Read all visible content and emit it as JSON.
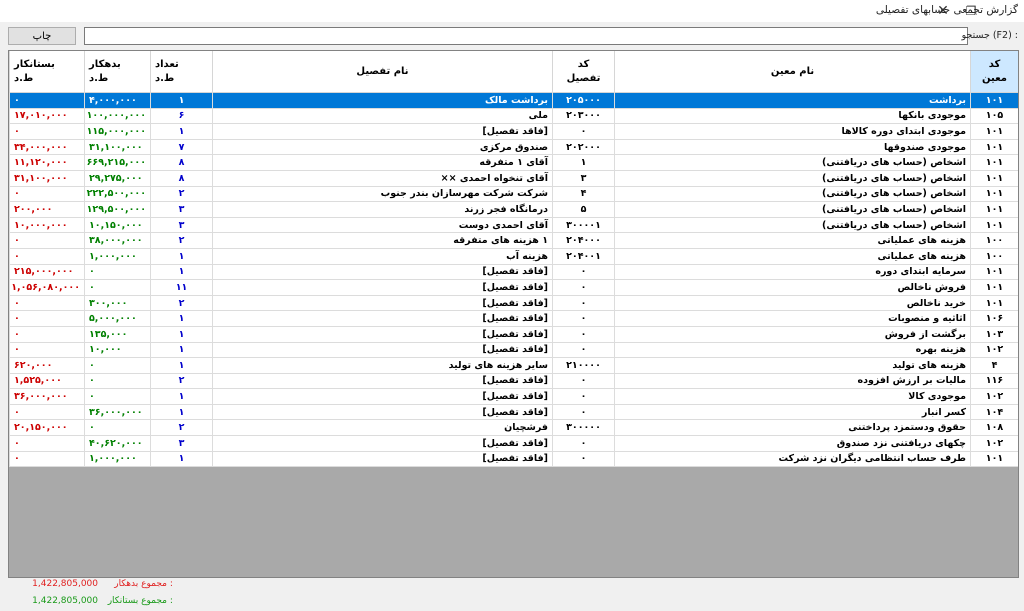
{
  "window": {
    "title": "گزارش تجمعی حسابهای تفصیلی",
    "restore_glyph": "❐",
    "close_glyph": "✕"
  },
  "toolbar": {
    "print_label": "چاپ",
    "search_label": "جستجو (F2) :",
    "search_value": ""
  },
  "columns": {
    "moin_code": "کد\nمعین",
    "moin_name": "نام معین",
    "detail_code": "کد\nتفصیل",
    "detail_name": "نام تفصیل",
    "count": "تعداد\nط.د",
    "debit": "بدهکار\nط.د",
    "credit": "بستانکار\nط.د"
  },
  "rows": [
    {
      "moin_code": "۱۰۱",
      "moin_name": "برداشت",
      "detail_code": "۲۰۵۰۰۰",
      "detail_name": "برداشت مالک",
      "count": "۱",
      "debit": "۴,۰۰۰,۰۰۰",
      "credit": "۰"
    },
    {
      "moin_code": "۱۰۵",
      "moin_name": "موجودی بانکها",
      "detail_code": "۲۰۳۰۰۰",
      "detail_name": "ملی",
      "count": "۶",
      "debit": "۱۰۰,۰۰۰,۰۰۰",
      "credit": "۱۷,۰۱۰,۰۰۰"
    },
    {
      "moin_code": "۱۰۱",
      "moin_name": "موجودی ابتدای دوره کالاها",
      "detail_code": "۰",
      "detail_name": "[فاقد تفصیل]",
      "count": "۱",
      "debit": "۱۱۵,۰۰۰,۰۰۰",
      "credit": "۰"
    },
    {
      "moin_code": "۱۰۱",
      "moin_name": "موجودی صندوقها",
      "detail_code": "۲۰۲۰۰۰",
      "detail_name": "صندوق مرکزی",
      "count": "۷",
      "debit": "۳۱,۱۰۰,۰۰۰",
      "credit": "۳۴,۰۰۰,۰۰۰"
    },
    {
      "moin_code": "۱۰۱",
      "moin_name": "اشخاص (حساب های دریافتنی)",
      "detail_code": "۱",
      "detail_name": "آقای ۱ متفرقه",
      "count": "۸",
      "debit": "۶۶۹,۲۱۵,۰۰۰",
      "credit": "۱۱,۱۲۰,۰۰۰"
    },
    {
      "moin_code": "۱۰۱",
      "moin_name": "اشخاص (حساب های دریافتنی)",
      "detail_code": "۳",
      "detail_name": "آقای تنخواه احمدی ××",
      "count": "۸",
      "debit": "۲۹,۲۷۵,۰۰۰",
      "credit": "۳۱,۱۰۰,۰۰۰"
    },
    {
      "moin_code": "۱۰۱",
      "moin_name": "اشخاص (حساب های دریافتنی)",
      "detail_code": "۴",
      "detail_name": "شرکت شرکت مهرسازان بندر جنوب",
      "count": "۲",
      "debit": "۲۲۲,۵۰۰,۰۰۰",
      "credit": "۰"
    },
    {
      "moin_code": "۱۰۱",
      "moin_name": "اشخاص (حساب های دریافتنی)",
      "detail_code": "۵",
      "detail_name": "درمانگاه فجر زرند",
      "count": "۳",
      "debit": "۱۲۹,۵۰۰,۰۰۰",
      "credit": "۲۰۰,۰۰۰"
    },
    {
      "moin_code": "۱۰۱",
      "moin_name": "اشخاص (حساب های دریافتنی)",
      "detail_code": "۳۰۰۰۰۱",
      "detail_name": "آقای احمدی دوست",
      "count": "۳",
      "debit": "۱۰,۱۵۰,۰۰۰",
      "credit": "۱۰,۰۰۰,۰۰۰"
    },
    {
      "moin_code": "۱۰۰",
      "moin_name": "هزینه های عملیاتی",
      "detail_code": "۲۰۴۰۰۰",
      "detail_name": "۱ هزینه های متفرقه",
      "count": "۲",
      "debit": "۳۸,۰۰۰,۰۰۰",
      "credit": "۰"
    },
    {
      "moin_code": "۱۰۰",
      "moin_name": "هزینه های عملیاتی",
      "detail_code": "۲۰۴۰۰۱",
      "detail_name": "هزینه آب",
      "count": "۱",
      "debit": "۱,۰۰۰,۰۰۰",
      "credit": "۰"
    },
    {
      "moin_code": "۱۰۱",
      "moin_name": "سرمایه ابتدای دوره",
      "detail_code": "۰",
      "detail_name": "[فاقد تفصیل]",
      "count": "۱",
      "debit": "۰",
      "credit": "۲۱۵,۰۰۰,۰۰۰"
    },
    {
      "moin_code": "۱۰۱",
      "moin_name": "فروش ناخالص",
      "detail_code": "۰",
      "detail_name": "[فاقد تفصیل]",
      "count": "۱۱",
      "debit": "۰",
      "credit": "۱,۰۵۶,۰۸۰,۰۰۰"
    },
    {
      "moin_code": "۱۰۱",
      "moin_name": "خرید ناخالص",
      "detail_code": "۰",
      "detail_name": "[فاقد تفصیل]",
      "count": "۲",
      "debit": "۳۰۰,۰۰۰",
      "credit": "۰"
    },
    {
      "moin_code": "۱۰۶",
      "moin_name": "اثاثیه و منصوبات",
      "detail_code": "۰",
      "detail_name": "[فاقد تفصیل]",
      "count": "۱",
      "debit": "۵,۰۰۰,۰۰۰",
      "credit": "۰"
    },
    {
      "moin_code": "۱۰۳",
      "moin_name": "برگشت از فروش",
      "detail_code": "۰",
      "detail_name": "[فاقد تفصیل]",
      "count": "۱",
      "debit": "۱۳۵,۰۰۰",
      "credit": "۰"
    },
    {
      "moin_code": "۱۰۲",
      "moin_name": "هزینه بهره",
      "detail_code": "۰",
      "detail_name": "[فاقد تفصیل]",
      "count": "۱",
      "debit": "۱۰,۰۰۰",
      "credit": "۰"
    },
    {
      "moin_code": "۴",
      "moin_name": "هزینه های تولید",
      "detail_code": "۲۱۰۰۰۰",
      "detail_name": "سایر هزینه های تولید",
      "count": "۱",
      "debit": "۰",
      "credit": "۶۲۰,۰۰۰"
    },
    {
      "moin_code": "۱۱۶",
      "moin_name": "مالیات بر ارزش افزوده",
      "detail_code": "۰",
      "detail_name": "[فاقد تفصیل]",
      "count": "۲",
      "debit": "۰",
      "credit": "۱,۵۲۵,۰۰۰"
    },
    {
      "moin_code": "۱۰۲",
      "moin_name": "موجودی کالا",
      "detail_code": "۰",
      "detail_name": "[فاقد تفصیل]",
      "count": "۱",
      "debit": "۰",
      "credit": "۳۶,۰۰۰,۰۰۰"
    },
    {
      "moin_code": "۱۰۴",
      "moin_name": "کسر انبار",
      "detail_code": "۰",
      "detail_name": "[فاقد تفصیل]",
      "count": "۱",
      "debit": "۳۶,۰۰۰,۰۰۰",
      "credit": "۰"
    },
    {
      "moin_code": "۱۰۸",
      "moin_name": "حقوق ودستمزد پرداختنی",
      "detail_code": "۳۰۰۰۰۰",
      "detail_name": "فرشچیان",
      "count": "۲",
      "debit": "۰",
      "credit": "۲۰,۱۵۰,۰۰۰"
    },
    {
      "moin_code": "۱۰۲",
      "moin_name": "چکهای دریافتنی نزد صندوق",
      "detail_code": "۰",
      "detail_name": "[فاقد تفصیل]",
      "count": "۳",
      "debit": "۴۰,۶۲۰,۰۰۰",
      "credit": "۰"
    },
    {
      "moin_code": "۱۰۱",
      "moin_name": "طرف حساب انتظامی دیگران نزد شرکت",
      "detail_code": "۰",
      "detail_name": "[فاقد تفصیل]",
      "count": "۱",
      "debit": "۱,۰۰۰,۰۰۰",
      "credit": "۰"
    }
  ],
  "totals": {
    "debit_label": "مجموع بدهکار :",
    "debit_value": "1,422,805,000",
    "credit_label": "مجموع بستانکار :",
    "credit_value": "1,422,805,000"
  },
  "colors": {
    "selection": "#0078d7",
    "count_text": "#0000cc",
    "debit_text": "#008000",
    "credit_text": "#cc0000"
  }
}
